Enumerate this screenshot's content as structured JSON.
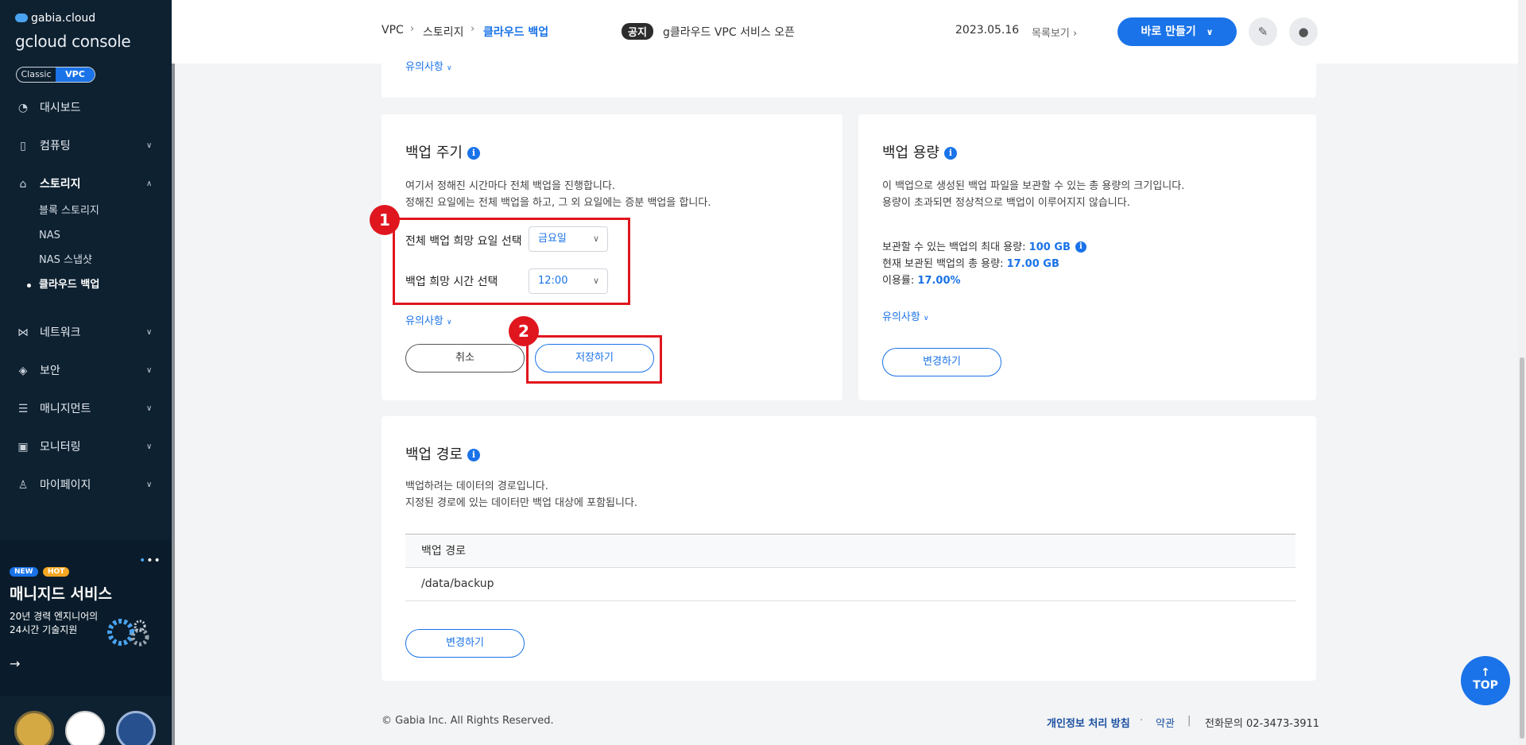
{
  "sidebar": {
    "brand": "gabia.cloud",
    "console_title": "gcloud console",
    "mode_classic": "Classic",
    "mode_vpc": "VPC",
    "items": [
      {
        "label": "대시보드"
      },
      {
        "label": "컴퓨팅"
      },
      {
        "label": "스토리지"
      },
      {
        "label": "네트워크"
      },
      {
        "label": "보안"
      },
      {
        "label": "매니지먼트"
      },
      {
        "label": "모니터링"
      },
      {
        "label": "마이페이지"
      }
    ],
    "storage_sub": [
      "블록 스토리지",
      "NAS",
      "NAS 스냅샷",
      "클라우드 백업"
    ],
    "promo": {
      "new": "NEW",
      "hot": "HOT",
      "title": "매니지드 서비스",
      "line1": "20년 경력 엔지니어의",
      "line2": "24시간 기술지원"
    }
  },
  "topbar": {
    "breadcrumb": [
      "VPC",
      "스토리지",
      "클라우드 백업"
    ],
    "notice_badge": "공지",
    "notice_text": "g클라우드 VPC 서비스 오픈",
    "notice_date": "2023.05.16",
    "notice_list": "목록보기",
    "quick_create": "바로 만들기"
  },
  "top_card": {
    "caution": "유의사항"
  },
  "backup_cycle": {
    "title": "백업 주기",
    "desc1": "여기서 정해진 시간마다 전체 백업을 진행합니다.",
    "desc2": "정해진 요일에는 전체 백업을 하고, 그 외 요일에는 증분 백업을 합니다.",
    "day_label": "전체 백업 희망 요일 선택",
    "day_value": "금요일",
    "time_label": "백업 희망 시간 선택",
    "time_value": "12:00",
    "caution": "유의사항",
    "cancel": "취소",
    "save": "저장하기",
    "marker1": "1",
    "marker2": "2"
  },
  "backup_capacity": {
    "title": "백업 용량",
    "desc1": "이 백업으로 생성된 백업 파일을 보관할 수 있는 총 용량의 크기입니다.",
    "desc2": "용량이 초과되면 정상적으로 백업이 이루어지지 않습니다.",
    "max_label": "보관할 수 있는 백업의 최대 용량:",
    "max_value": "100 GB",
    "used_label": "현재 보관된 백업의 총 용량:",
    "used_value": "17.00 GB",
    "rate_label": "이용률:",
    "rate_value": "17.00%",
    "caution": "유의사항",
    "change": "변경하기"
  },
  "backup_path": {
    "title": "백업 경로",
    "desc1": "백업하려는 데이터의 경로입니다.",
    "desc2": "지정된 경로에 있는 데이터만 백업 대상에 포함됩니다.",
    "column": "백업 경로",
    "rows": [
      "/data/backup"
    ],
    "change": "변경하기"
  },
  "footer": {
    "copyright": "© Gabia Inc. All Rights Reserved.",
    "privacy": "개인정보 처리 방침",
    "terms": "약관",
    "phone": "전화문의  02-3473-3911"
  },
  "top_button": "TOP",
  "colors": {
    "accent": "#1a73e8",
    "sidebar": "#0e2131",
    "highlight": "#e0161e"
  }
}
